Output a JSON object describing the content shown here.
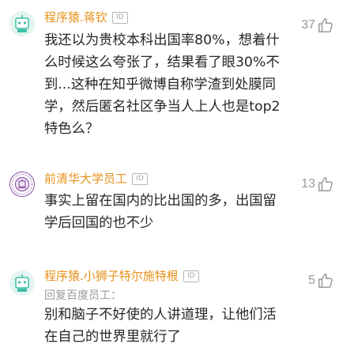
{
  "comments": [
    {
      "author": "程序猿.蒋钦",
      "badge": "ID",
      "likes": "37",
      "lines": [
        "我还以为贵校本科出国率80%，想着什",
        "么时候这么夸张了，结果看了眼30%不",
        "到...这种在知乎微博自称学渣到处膜同",
        "学，然后匿名社区争当人上人也是top2",
        "特色么？"
      ]
    },
    {
      "author": "前清华大学员工",
      "badge": "ID",
      "likes": "13",
      "lines": [
        "事实上留在国内的比出国的多，出国留",
        "学后回国的也不少"
      ]
    },
    {
      "author": "程序猿.小狮子特尔施特根",
      "badge": "ID",
      "likes": "5",
      "reply_to": "回复百度员工：",
      "lines": [
        "别和脑子不好使的人讲道理，让他们活",
        "在自己的世界里就行了"
      ]
    }
  ],
  "colors": {
    "author": "#e8911c",
    "body": "#262626",
    "muted": "#9a9a9a",
    "avatar_robot": "#3dbfa6",
    "avatar_tsinghua": "#7a3c96"
  },
  "icons": {
    "like": "thumb-up-icon",
    "avatar_robot": "robot-avatar-icon",
    "avatar_tsinghua": "tsinghua-emblem-icon"
  }
}
